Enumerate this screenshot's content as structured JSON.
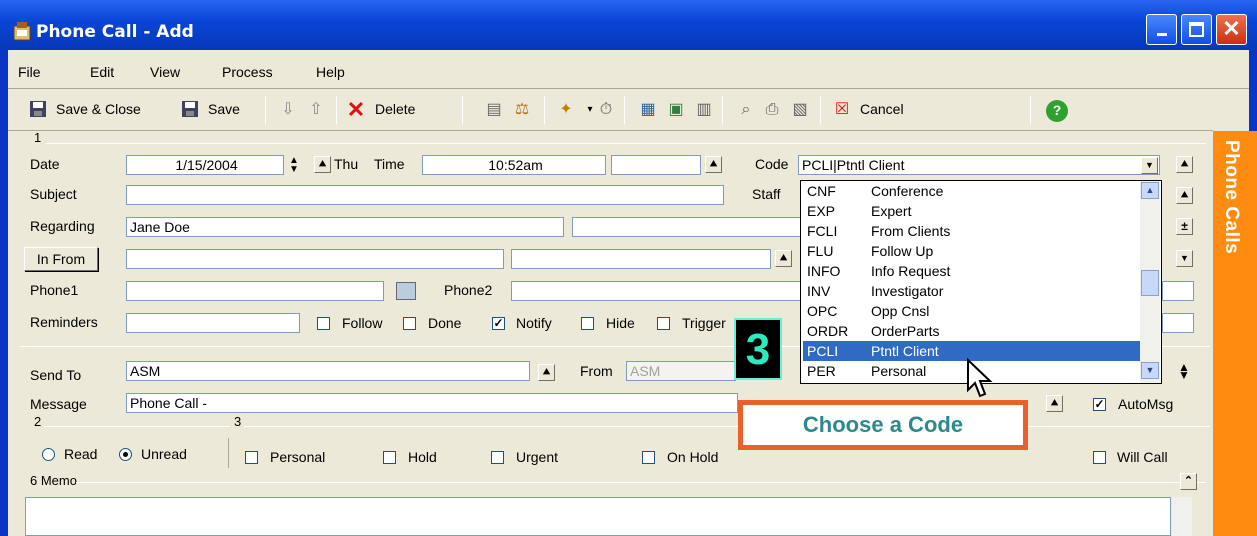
{
  "window": {
    "title": "Phone Call - Add"
  },
  "menu": [
    "File",
    "Edit",
    "View",
    "Process",
    "Help"
  ],
  "toolbar": {
    "save_close": "Save & Close",
    "save": "Save",
    "delete": "Delete",
    "cancel": "Cancel"
  },
  "section1": {
    "number": "1",
    "date_label": "Date",
    "date_value": "1/15/2004",
    "weekday": "Thu",
    "time_label": "Time",
    "time_value": "10:52am",
    "code_label": "Code",
    "code_value": "PCLI|Ptntl Client",
    "subject_label": "Subject",
    "subject_value": "",
    "staff_label": "Staff",
    "regarding_label": "Regarding",
    "regarding_value": "Jane Doe",
    "in_from_button": "In From",
    "phone1_label": "Phone1",
    "phone2_label": "Phone2",
    "reminders_label": "Reminders",
    "checks": [
      {
        "label": "Follow",
        "checked": false
      },
      {
        "label": "Done",
        "checked": false
      },
      {
        "label": "Notify",
        "checked": true
      },
      {
        "label": "Hide",
        "checked": false
      },
      {
        "label": "Trigger",
        "checked": false
      }
    ]
  },
  "code_dropdown": {
    "items": [
      {
        "code": "CNF",
        "name": "Conference"
      },
      {
        "code": "EXP",
        "name": "Expert"
      },
      {
        "code": "FCLI",
        "name": "From Clients"
      },
      {
        "code": "FLU",
        "name": "Follow Up"
      },
      {
        "code": "INFO",
        "name": "Info Request"
      },
      {
        "code": "INV",
        "name": "Investigator"
      },
      {
        "code": "OPC",
        "name": "Opp Cnsl"
      },
      {
        "code": "ORDR",
        "name": "OrderParts"
      },
      {
        "code": "PCLI",
        "name": "Ptntl Client"
      },
      {
        "code": "PER",
        "name": "Personal"
      }
    ],
    "selected_index": 8
  },
  "message_section": {
    "send_to_label": "Send To",
    "send_to_value": "ASM",
    "from_label": "From",
    "from_value": "ASM",
    "message_label": "Message",
    "message_value": "Phone Call -",
    "automsg_label": "AutoMsg",
    "automsg_checked": true
  },
  "section2": {
    "number": "2",
    "read_label": "Read",
    "unread_label": "Unread",
    "selected": "Unread"
  },
  "section3": {
    "number": "3",
    "checks": [
      "Personal",
      "Hold",
      "Urgent",
      "On Hold",
      "Will Call"
    ]
  },
  "memo": {
    "label": "6 Memo"
  },
  "sidebar": {
    "label": "Phone Calls",
    "color": "#ff8c10"
  },
  "callout": {
    "text": "Choose a Code",
    "border_color": "#e8602c"
  },
  "step_badge": {
    "text": "3"
  }
}
